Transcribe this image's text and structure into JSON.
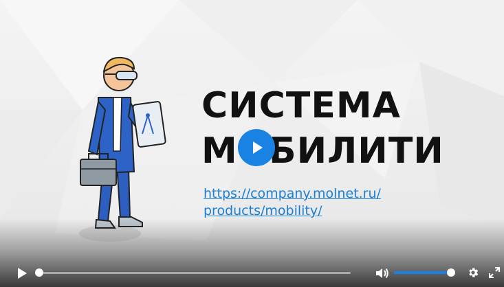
{
  "video": {
    "title_line1": "СИСТЕМА",
    "title_line2": "МОБИЛИТИ",
    "link_line1": "https://company.molnet.ru/",
    "link_line2": "products/mobility/"
  },
  "controls": {
    "progress_fraction": 0.0,
    "volume_fraction": 1.0,
    "icons": [
      "play-icon",
      "volume-icon",
      "gear-icon",
      "fullscreen-icon"
    ]
  },
  "colors": {
    "accent": "#1a82e2",
    "link": "#1a7fd4",
    "title": "#111111"
  }
}
